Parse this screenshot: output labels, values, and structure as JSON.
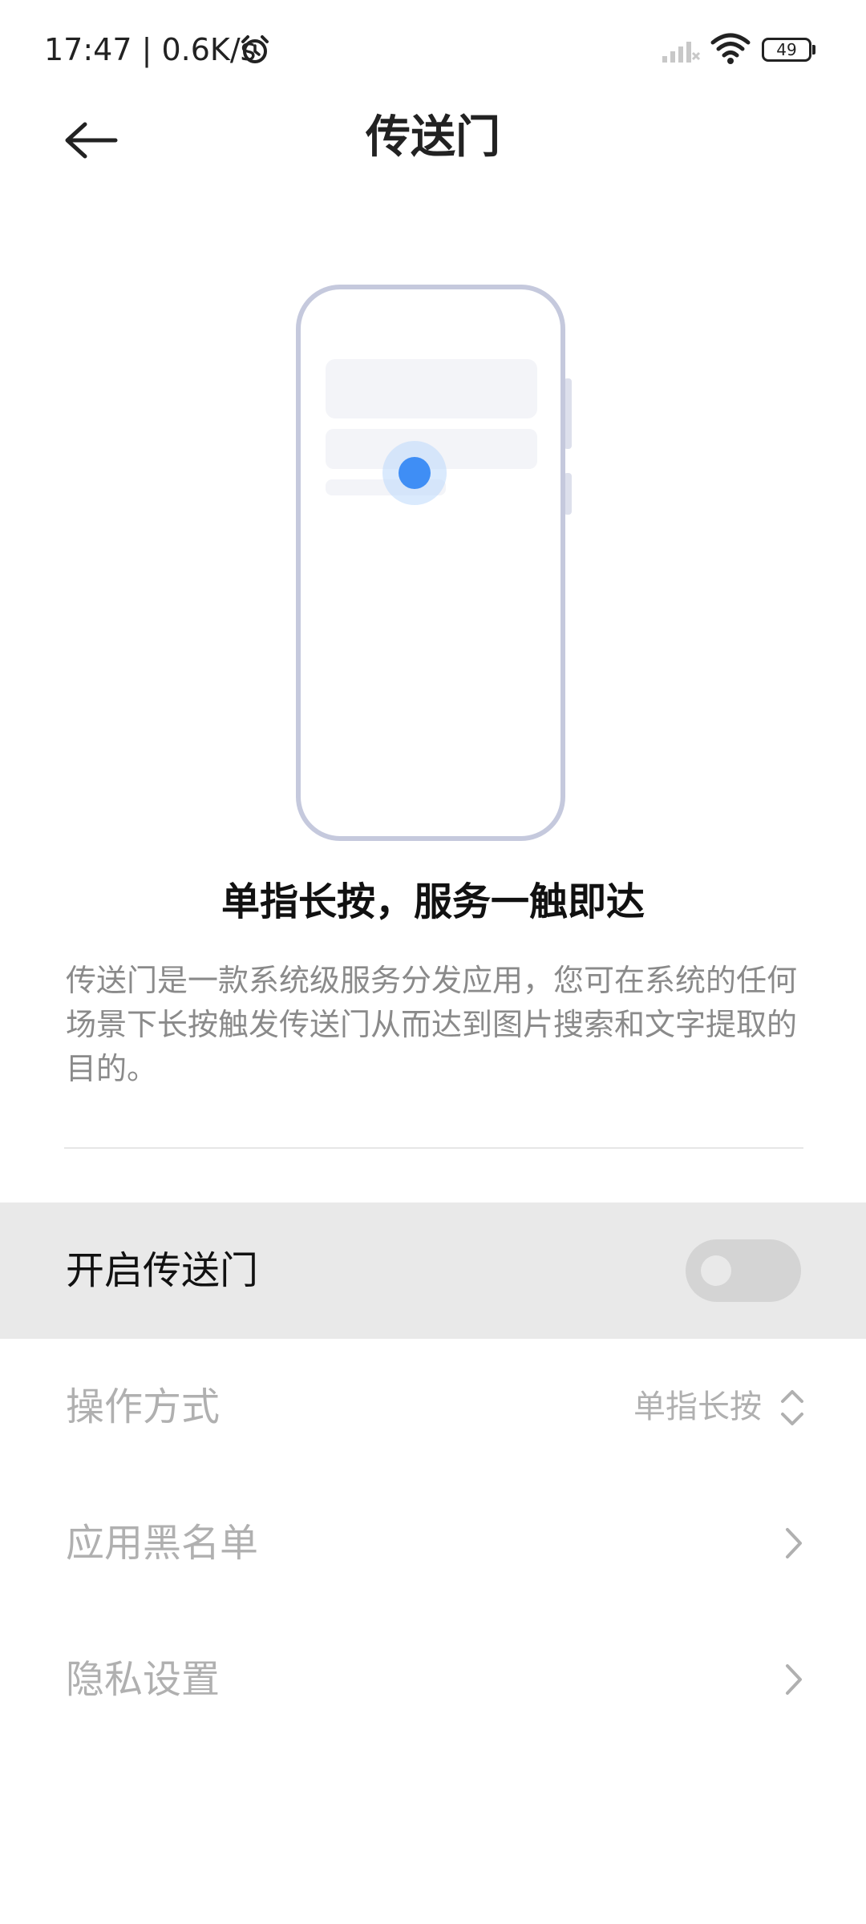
{
  "status_bar": {
    "time_speed": "17:47 | 0.6K/s",
    "battery_level": "49"
  },
  "header": {
    "title": "传送门"
  },
  "intro": {
    "heading": "单指长按，服务一触即达",
    "description": "传送门是一款系统级服务分发应用，您可在系统的任何场景下长按触发传送门从而达到图片搜索和文字提取的目的。"
  },
  "settings": {
    "enable_label": "开启传送门",
    "enable_on": false,
    "operation_label": "操作方式",
    "operation_value": "单指长按",
    "blacklist_label": "应用黑名单",
    "privacy_label": "隐私设置"
  },
  "colors": {
    "accent_dot": "#3f8ef5",
    "phone_outline": "#c5c9dd",
    "toggle_row_bg": "#e9e9e9"
  }
}
